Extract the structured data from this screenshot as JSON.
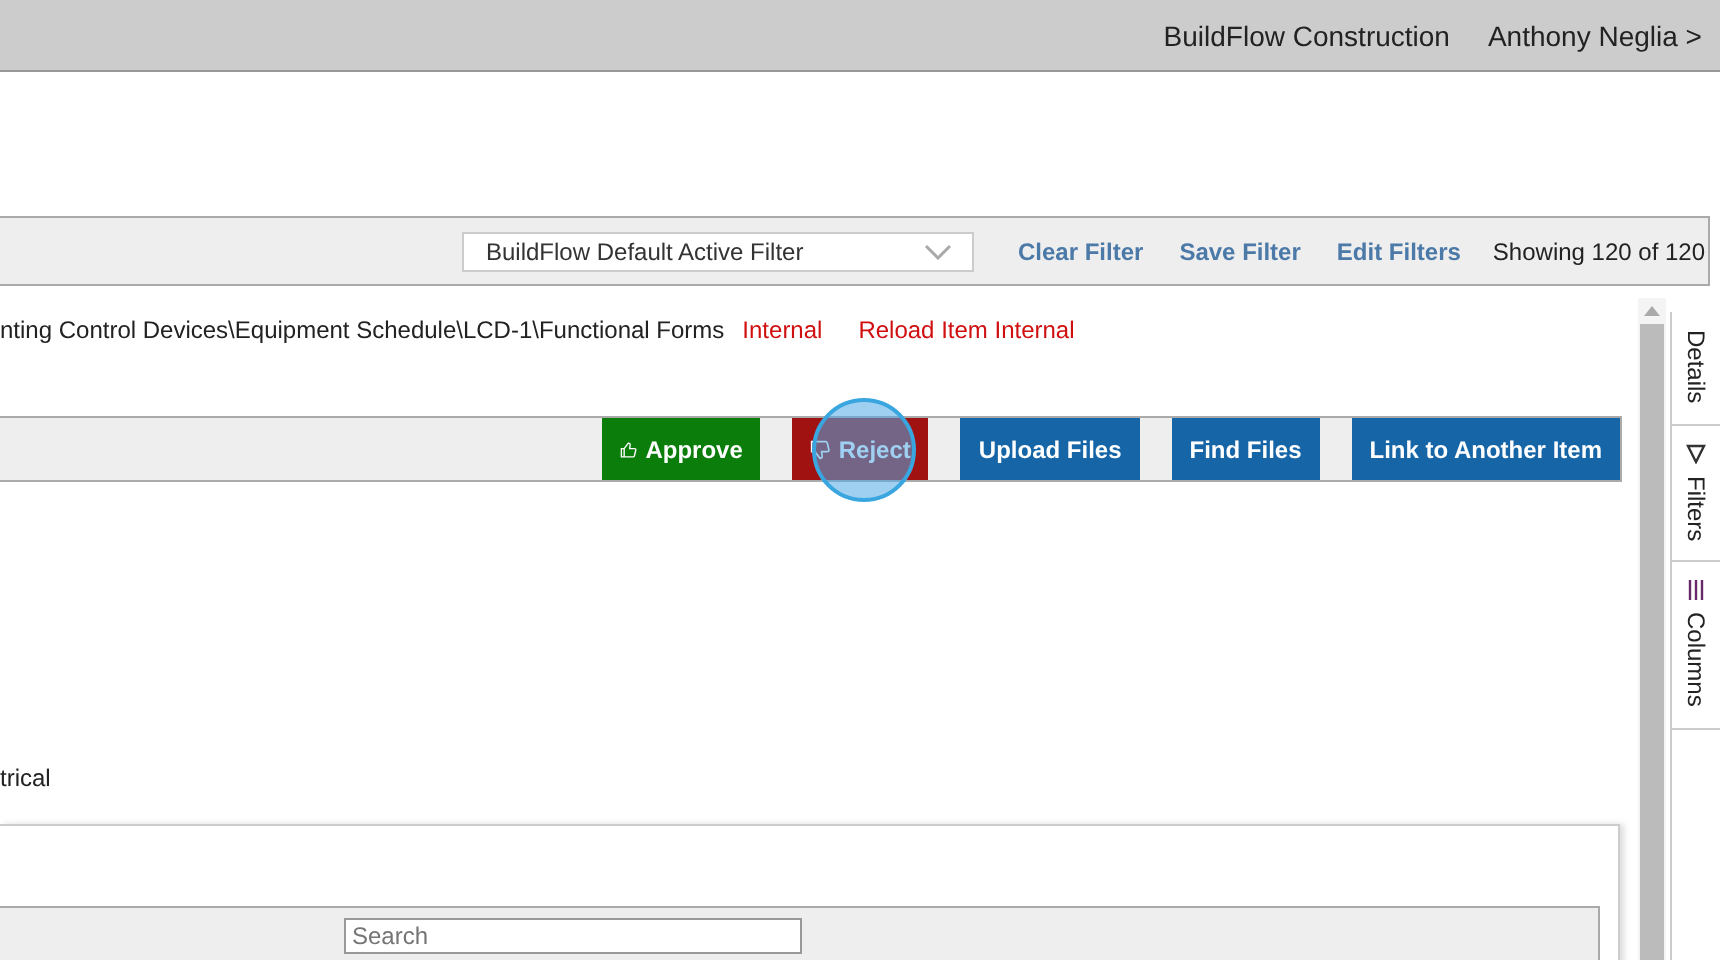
{
  "header": {
    "company": "BuildFlow Construction",
    "user": "Anthony Neglia >"
  },
  "filter_bar": {
    "select": {
      "value": "BuildFlow Default Active Filter"
    },
    "links": [
      "Clear Filter",
      "Save Filter",
      "Edit Filters"
    ],
    "count": "Showing 120 of 120"
  },
  "breadcrumb": {
    "path": "nting Control Devices\\Equipment Schedule\\LCD-1\\Functional Forms",
    "tags": [
      "Internal",
      "Reload Item Internal"
    ]
  },
  "actions": [
    {
      "label": "Approve",
      "kind": "approve"
    },
    {
      "label": "Reject",
      "kind": "reject"
    },
    {
      "label": "Upload Files",
      "kind": "plain"
    },
    {
      "label": "Find Files",
      "kind": "plain"
    },
    {
      "label": "Link to Another Item",
      "kind": "plain"
    }
  ],
  "field_text": "trical",
  "panel": {
    "search": {
      "placeholder": "Search"
    }
  },
  "side_tabs": [
    {
      "label": "Details",
      "kind": "details"
    },
    {
      "label": "Filters",
      "kind": "filters"
    },
    {
      "label": "Columns",
      "kind": "columns"
    }
  ]
}
